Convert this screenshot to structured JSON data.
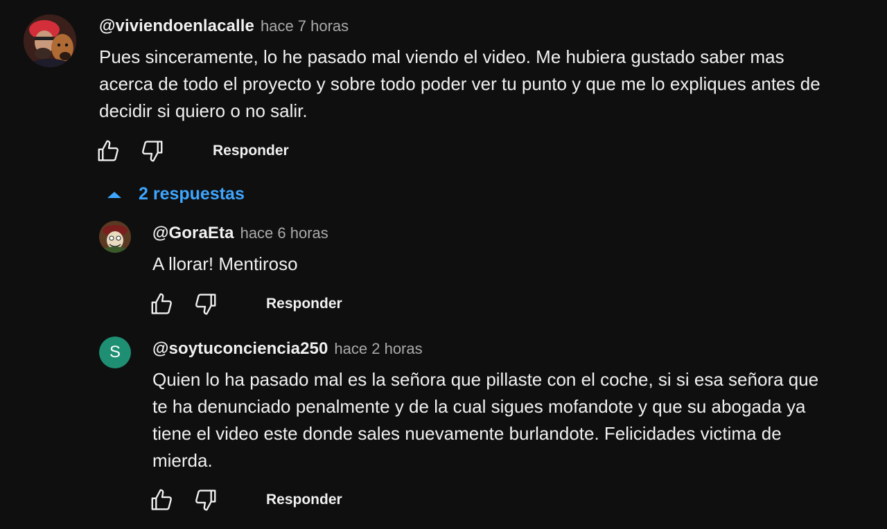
{
  "comment": {
    "author": "@viviendoenlacalle",
    "time": "hace 7 horas",
    "text": "Pues sinceramente, lo he pasado mal viendo el video. Me hubiera gustado saber mas acerca de todo el proyecto y sobre todo poder ver tu punto y que me lo expliques antes de decidir si quiero o no salir.",
    "reply_label": "Responder"
  },
  "replies_toggle": {
    "label": "2 respuestas",
    "accent_color": "#3ea6ff"
  },
  "replies": [
    {
      "author": "@GoraEta",
      "time": "hace 6 horas",
      "text": "A llorar! Mentiroso",
      "reply_label": "Responder"
    },
    {
      "author": "@soytuconciencia250",
      "time": "hace 2 horas",
      "avatar_letter": "S",
      "avatar_color": "#1f8f73",
      "text": "Quien lo ha pasado mal es la señora que pillaste con el coche, si si esa señora que te ha denunciado penalmente y de la cual sigues mofandote y que su abogada ya tiene el video este donde sales nuevamente burlandote. Felicidades victima de mierda.",
      "reply_label": "Responder"
    }
  ],
  "icons": {
    "like": "thumb-up-icon",
    "dislike": "thumb-down-icon",
    "toggle": "caret-up-icon"
  }
}
